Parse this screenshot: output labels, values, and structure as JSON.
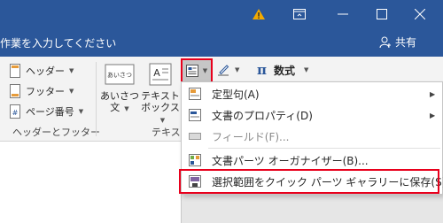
{
  "titlebar": {
    "warning_icon": "warning-icon",
    "ribbon_display_icon": "ribbon-display-icon"
  },
  "tellme": {
    "text": "作業を入力してください",
    "share_label": "共有"
  },
  "ribbon": {
    "header_label": "ヘッダー",
    "footer_label": "フッター",
    "page_number_label": "ページ番号",
    "group_header_footer": "ヘッダーとフッター",
    "greeting_label_line1": "あいさつ",
    "greeting_label_line2": "文",
    "greeting_icon_text": "あいさつ",
    "textbox_label_line1": "テキスト",
    "textbox_label_line2": "ボックス",
    "group_text": "テキス",
    "equation_label": "数式",
    "pi_symbol": "π"
  },
  "quick_parts_menu": {
    "items": [
      {
        "label": "定型句(A)",
        "submenu": true,
        "enabled": true
      },
      {
        "label": "文書のプロパティ(D)",
        "submenu": true,
        "enabled": true
      },
      {
        "label": "フィールド(F)...",
        "submenu": false,
        "enabled": false
      },
      {
        "label": "文書パーツ オーガナイザー(B)...",
        "submenu": false,
        "enabled": true
      },
      {
        "label": "選択範囲をクイック パーツ ギャラリーに保存(S)...",
        "submenu": false,
        "enabled": true
      }
    ]
  },
  "colors": {
    "title_bar": "#2b579a",
    "ribbon_bg": "#f3f3f3",
    "highlight": "#e8001c"
  }
}
